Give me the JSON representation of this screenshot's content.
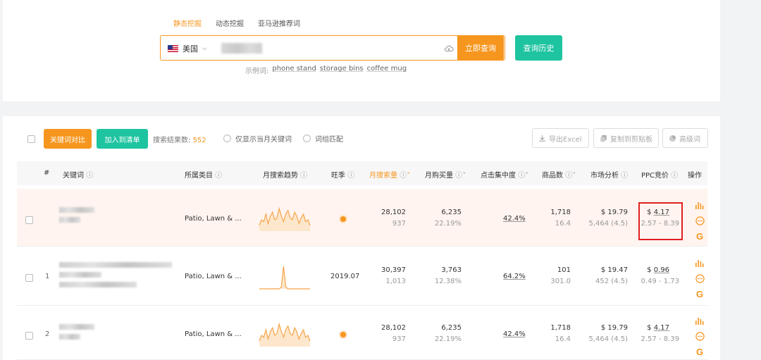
{
  "search": {
    "tabs": [
      "静态挖掘",
      "动态挖掘",
      "亚马逊推荐词"
    ],
    "active_tab": 0,
    "country": "美国",
    "query_button": "立即查询",
    "history_button": "查询历史",
    "examples_label": "示例词:",
    "examples": [
      "phone stand",
      "storage bins",
      "coffee mug"
    ]
  },
  "toolbar": {
    "compare_button": "关键词对比",
    "add_list_button": "加入到清单",
    "result_label": "搜索结果数:",
    "result_count": "552",
    "only_current_month": "仅显示当月关键词",
    "root_match": "词组匹配",
    "export_excel": "导出Excel",
    "copy_clipboard": "复制到剪贴板",
    "advanced": "高级词"
  },
  "table": {
    "headers": {
      "index": "#",
      "keyword": "关键词",
      "category": "所属类目",
      "trend": "月搜索趋势",
      "season": "旺季",
      "monthly_search": "月搜索量",
      "monthly_sales": "月购买量",
      "click_concentration": "点击集中度",
      "product_count": "商品数",
      "market": "市场分析",
      "ppc": "PPC竞价",
      "action": "操作"
    },
    "rows": [
      {
        "index": "",
        "category": "Patio, Lawn & ...",
        "season": "",
        "search_volume": "28,102",
        "search_sub": "937",
        "sales": "6,235",
        "sales_sub": "22.19%",
        "concentration": "42.4%",
        "products": "1,718",
        "products_sub": "16.4",
        "market_price": "$ 19.79",
        "market_sub": "5,464 (4.5)",
        "ppc_currency": "$",
        "ppc_value": "4.17",
        "ppc_range": "2.57 - 8.39",
        "trend": [
          3,
          6,
          5,
          9,
          4,
          8,
          10,
          6,
          7,
          12,
          8,
          5,
          9,
          11,
          7,
          6,
          10,
          8,
          4,
          7,
          9,
          5,
          6,
          3
        ]
      },
      {
        "index": "1",
        "category": "Patio, Lawn & ...",
        "season": "2019.07",
        "search_volume": "30,397",
        "search_sub": "1,013",
        "sales": "3,763",
        "sales_sub": "12.38%",
        "concentration": "64.2%",
        "products": "101",
        "products_sub": "301.0",
        "market_price": "$ 19.47",
        "market_sub": "452 (4.5)",
        "ppc_currency": "$",
        "ppc_value": "0.96",
        "ppc_range": "0.49 - 1.73",
        "trend": [
          0,
          0,
          0,
          0,
          0,
          0,
          0,
          0,
          0,
          0,
          1,
          12,
          1,
          0,
          0,
          0,
          0,
          0,
          0,
          0,
          0,
          0,
          0,
          0
        ]
      },
      {
        "index": "2",
        "category": "Patio, Lawn & ...",
        "season": "",
        "search_volume": "28,102",
        "search_sub": "937",
        "sales": "6,235",
        "sales_sub": "22.19%",
        "concentration": "42.4%",
        "products": "1,718",
        "products_sub": "16.4",
        "market_price": "$ 19.79",
        "market_sub": "5,464 (4.5)",
        "ppc_currency": "$",
        "ppc_value": "4.17",
        "ppc_range": "2.57 - 8.39",
        "trend": [
          3,
          6,
          5,
          9,
          4,
          8,
          10,
          6,
          7,
          12,
          8,
          5,
          9,
          11,
          7,
          6,
          10,
          8,
          4,
          7,
          9,
          5,
          6,
          3
        ]
      }
    ]
  },
  "colors": {
    "accent": "#f6961e",
    "green": "#1ec4a0",
    "highlight": "#e02020"
  }
}
